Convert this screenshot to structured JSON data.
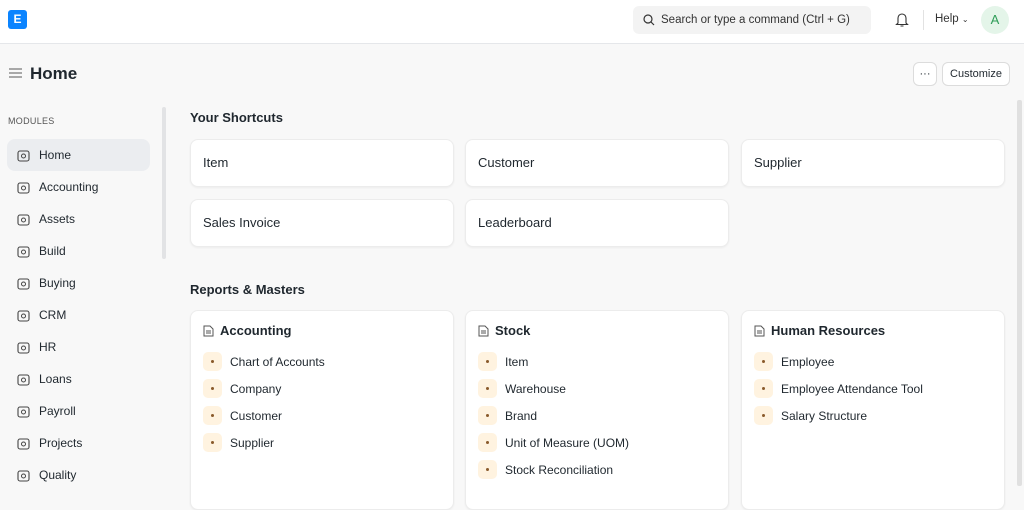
{
  "topbar": {
    "logo": "E",
    "search_placeholder": "Search or type a command (Ctrl + G)",
    "help": "Help",
    "avatar": "A"
  },
  "page": {
    "title": "Home",
    "more": "···",
    "customize": "Customize"
  },
  "sidebar": {
    "heading": "MODULES",
    "items": [
      {
        "label": "Home",
        "icon": "tools-icon"
      },
      {
        "label": "Accounting"
      },
      {
        "label": "Assets"
      },
      {
        "label": "Build"
      },
      {
        "label": "Buying"
      },
      {
        "label": "CRM"
      },
      {
        "label": "HR"
      },
      {
        "label": "Loans"
      },
      {
        "label": "Payroll"
      },
      {
        "label": "Projects"
      },
      {
        "label": "Quality"
      }
    ]
  },
  "shortcuts": {
    "heading": "Your Shortcuts",
    "items": [
      "Item",
      "Customer",
      "Supplier",
      "Sales Invoice",
      "Leaderboard"
    ]
  },
  "reports": {
    "heading": "Reports & Masters",
    "cards": [
      {
        "title": "Accounting",
        "links": [
          "Chart of Accounts",
          "Company",
          "Customer",
          "Supplier"
        ]
      },
      {
        "title": "Stock",
        "links": [
          "Item",
          "Warehouse",
          "Brand",
          "Unit of Measure (UOM)",
          "Stock Reconciliation"
        ]
      },
      {
        "title": "Human Resources",
        "links": [
          "Employee",
          "Employee Attendance Tool",
          "Salary Structure"
        ]
      }
    ]
  }
}
